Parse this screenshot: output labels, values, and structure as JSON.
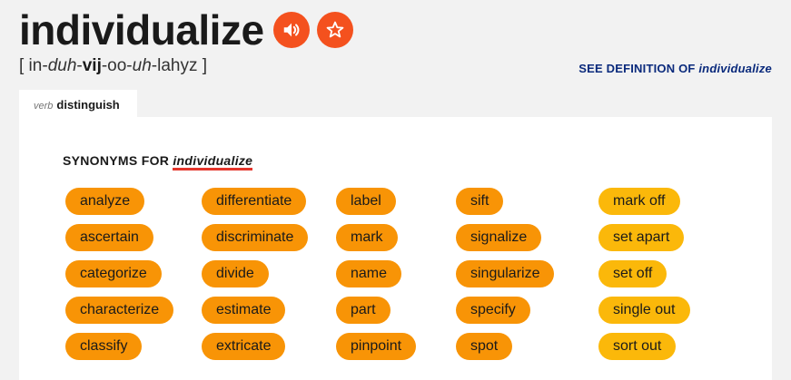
{
  "header": {
    "headword": "individualize",
    "pronunciation": {
      "open": "[ in-",
      "s1": "duh",
      "d1": "-",
      "s2": "vij",
      "d2": "-oo-",
      "s3": "uh",
      "d3": "-lahyz ]"
    },
    "see_definition": {
      "prefix": "SEE DEFINITION OF ",
      "word": "individualize"
    },
    "audio_icon": "speaker-icon",
    "favorite_icon": "star-icon",
    "accent_color": "#f4511e"
  },
  "tab": {
    "pos": "verb",
    "label": "distinguish"
  },
  "synonyms": {
    "heading_prefix": "SYNONYMS FOR ",
    "heading_word": "individualize",
    "columns": [
      [
        "analyze",
        "ascertain",
        "categorize",
        "characterize",
        "classify"
      ],
      [
        "differentiate",
        "discriminate",
        "divide",
        "estimate",
        "extricate"
      ],
      [
        "label",
        "mark",
        "name",
        "part",
        "pinpoint"
      ],
      [
        "sift",
        "signalize",
        "singularize",
        "specify",
        "spot"
      ],
      [
        "mark off",
        "set apart",
        "set off",
        "single out",
        "sort out"
      ]
    ],
    "pill_color": "#f89406",
    "pill_color_light": "#fbb80a"
  }
}
